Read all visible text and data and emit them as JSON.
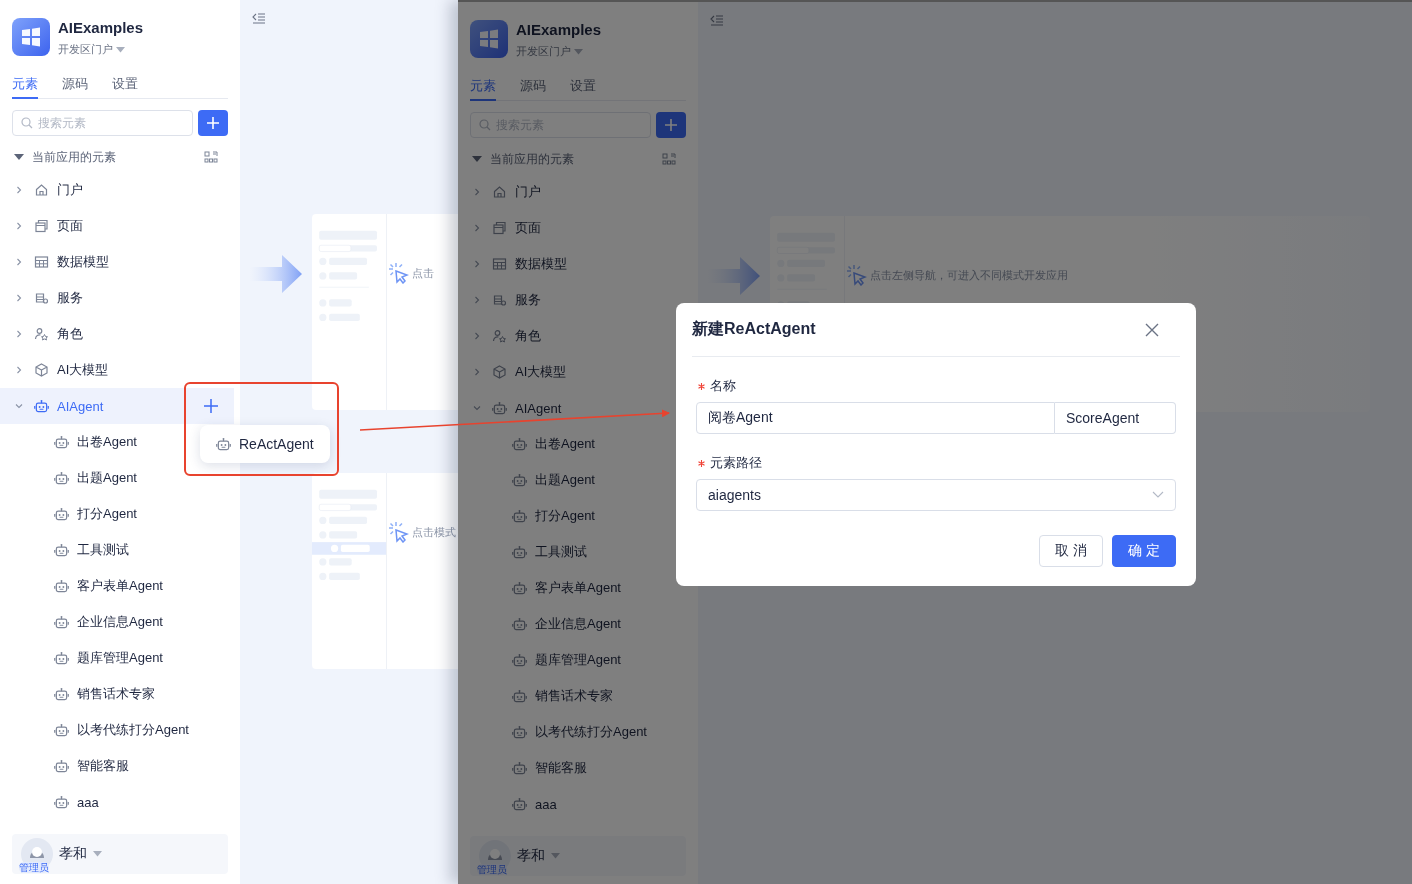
{
  "screens": [
    {
      "app": {
        "name": "AIExamples",
        "portal": "开发区门户"
      },
      "tabs": [
        {
          "label": "元素",
          "selected": true
        },
        {
          "label": "源码",
          "selected": false
        },
        {
          "label": "设置",
          "selected": false
        }
      ],
      "search": {
        "placeholder": "搜索元素"
      },
      "tree": {
        "label": "当前应用的元素",
        "expanded": true,
        "items": [
          {
            "label": "门户",
            "kind": "portal",
            "expanded": false,
            "selected": false,
            "hovered": false
          },
          {
            "label": "页面",
            "kind": "page",
            "expanded": false,
            "selected": false,
            "hovered": false
          },
          {
            "label": "数据模型",
            "kind": "table",
            "expanded": false,
            "selected": false,
            "hovered": false
          },
          {
            "label": "服务",
            "kind": "service",
            "expanded": false,
            "selected": false,
            "hovered": false
          },
          {
            "label": "角色",
            "kind": "role",
            "expanded": false,
            "selected": false,
            "hovered": false
          },
          {
            "label": "AI大模型",
            "kind": "model",
            "expanded": false,
            "selected": false,
            "hovered": false
          },
          {
            "label": "AIAgent",
            "kind": "agent",
            "expanded": true,
            "selected": true,
            "hovered": true,
            "children": [
              {
                "label": "出卷Agent",
                "kind": "agent",
                "selected": false
              },
              {
                "label": "出题Agent",
                "kind": "agent",
                "selected": false
              },
              {
                "label": "打分Agent",
                "kind": "agent",
                "selected": false
              },
              {
                "label": "工具测试",
                "kind": "agent",
                "selected": false
              },
              {
                "label": "客户表单Agent",
                "kind": "agent",
                "selected": false
              },
              {
                "label": "企业信息Agent",
                "kind": "agent",
                "selected": false
              },
              {
                "label": "题库管理Agent",
                "kind": "agent",
                "selected": false
              },
              {
                "label": "销售话术专家",
                "kind": "agent",
                "selected": false
              },
              {
                "label": "以考代练打分Agent",
                "kind": "agent",
                "selected": false
              },
              {
                "label": "智能客服",
                "kind": "agent",
                "selected": false
              },
              {
                "label": "aaa",
                "kind": "agent",
                "selected": false
              }
            ]
          }
        ]
      },
      "user": {
        "name": "孝和",
        "role": "管理员"
      },
      "cards": [
        {
          "hint": "点击",
          "row_selected": false
        },
        {
          "hint": "点击模式",
          "row_selected": true
        }
      ],
      "add_menu": {
        "items": [
          {
            "label": "ReActAgent",
            "kind": "agent"
          }
        ]
      }
    },
    {
      "app": {
        "name": "AIExamples",
        "portal": "开发区门户"
      },
      "tabs": [
        {
          "label": "元素",
          "selected": true
        },
        {
          "label": "源码",
          "selected": false
        },
        {
          "label": "设置",
          "selected": false
        }
      ],
      "search": {
        "placeholder": "搜索元素"
      },
      "tree": {
        "label": "当前应用的元素",
        "expanded": true,
        "items": [
          {
            "label": "门户",
            "kind": "portal",
            "expanded": false,
            "selected": false,
            "hovered": false
          },
          {
            "label": "页面",
            "kind": "page",
            "expanded": false,
            "selected": false,
            "hovered": false
          },
          {
            "label": "数据模型",
            "kind": "table",
            "expanded": false,
            "selected": false,
            "hovered": false
          },
          {
            "label": "服务",
            "kind": "service",
            "expanded": false,
            "selected": false,
            "hovered": false
          },
          {
            "label": "角色",
            "kind": "role",
            "expanded": false,
            "selected": false,
            "hovered": false
          },
          {
            "label": "AI大模型",
            "kind": "model",
            "expanded": false,
            "selected": false,
            "hovered": false
          },
          {
            "label": "AIAgent",
            "kind": "agent",
            "expanded": true,
            "selected": false,
            "hovered": false,
            "children": [
              {
                "label": "出卷Agent",
                "kind": "agent",
                "selected": false
              },
              {
                "label": "出题Agent",
                "kind": "agent",
                "selected": false
              },
              {
                "label": "打分Agent",
                "kind": "agent",
                "selected": false
              },
              {
                "label": "工具测试",
                "kind": "agent",
                "selected": false
              },
              {
                "label": "客户表单Agent",
                "kind": "agent",
                "selected": false
              },
              {
                "label": "企业信息Agent",
                "kind": "agent",
                "selected": false
              },
              {
                "label": "题库管理Agent",
                "kind": "agent",
                "selected": false
              },
              {
                "label": "销售话术专家",
                "kind": "agent",
                "selected": false
              },
              {
                "label": "以考代练打分Agent",
                "kind": "agent",
                "selected": false
              },
              {
                "label": "智能客服",
                "kind": "agent",
                "selected": false
              },
              {
                "label": "aaa",
                "kind": "agent",
                "selected": false
              }
            ]
          }
        ]
      },
      "user": {
        "name": "孝和",
        "role": "管理员"
      },
      "cards": [
        {
          "hint": "点击左侧导航，可进入不同模式开发应用",
          "row_selected": false
        }
      ],
      "dialog": {
        "title": "新建ReActAgent",
        "fields": [
          {
            "label": "名称",
            "required": true,
            "kind": "text",
            "value": "阅卷Agent",
            "addon": "ScoreAgent"
          },
          {
            "label": "元素路径",
            "required": true,
            "kind": "select",
            "value": "aiagents"
          }
        ],
        "buttons": [
          {
            "label": "取 消",
            "kind": "default"
          },
          {
            "label": "确 定",
            "kind": "primary"
          }
        ]
      }
    }
  ]
}
